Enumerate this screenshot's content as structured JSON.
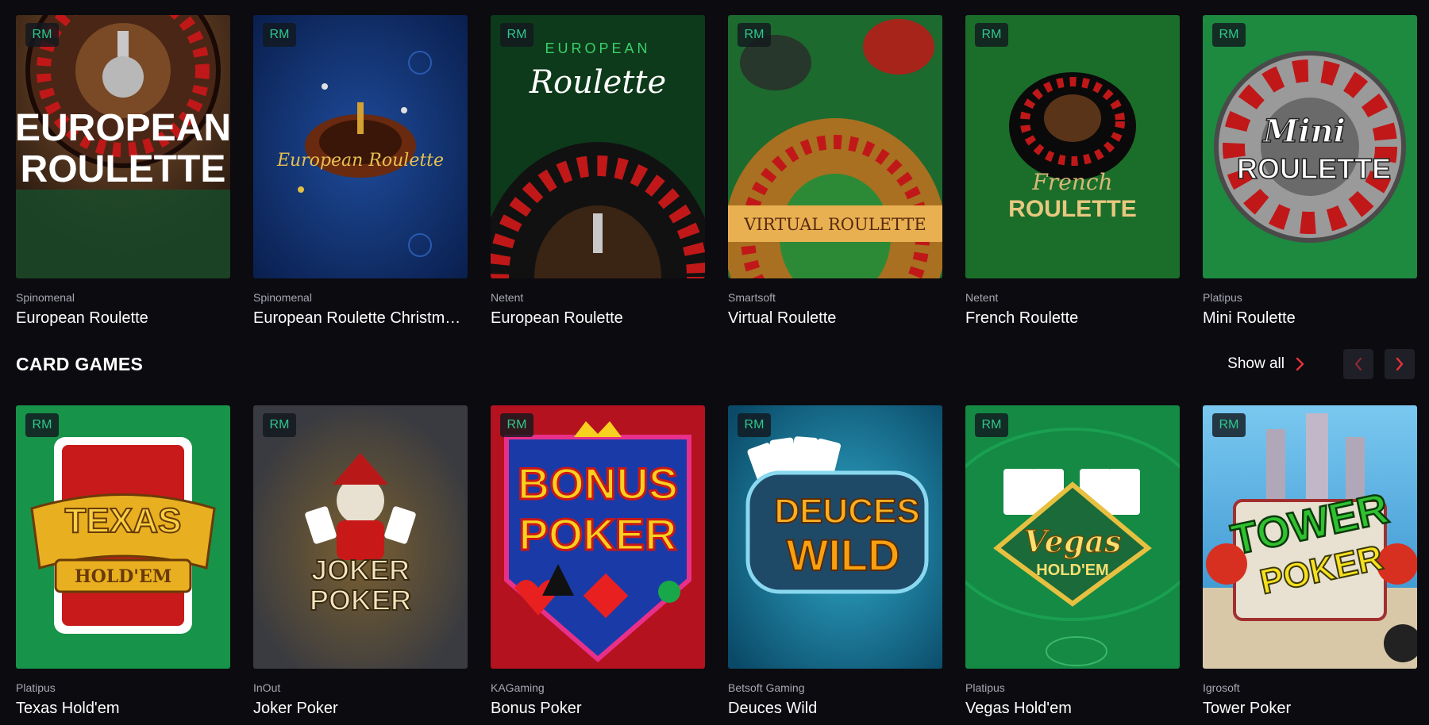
{
  "badge_label": "RM",
  "roulette_row": [
    {
      "provider": "Spinomenal",
      "title": "European Roulette",
      "art_text": [
        "EUROPEAN",
        "ROULETTE"
      ],
      "bg": "#5a3a22"
    },
    {
      "provider": "Spinomenal",
      "title": "European Roulette Christmas Edition",
      "art_text": [
        "European Roulette"
      ],
      "bg": "#10306a"
    },
    {
      "provider": "Netent",
      "title": "European Roulette",
      "art_text": [
        "EUROPEAN",
        "Roulette"
      ],
      "bg": "#0d3a1a"
    },
    {
      "provider": "Smartsoft",
      "title": "Virtual Roulette",
      "art_text": [
        "VIRTUAL ROULETTE"
      ],
      "bg": "#1c6a2e"
    },
    {
      "provider": "Netent",
      "title": "French Roulette",
      "art_text": [
        "French",
        "ROULETTE"
      ],
      "bg": "#1b6e2a"
    },
    {
      "provider": "Platipus",
      "title": "Mini Roulette",
      "art_text": [
        "Mini",
        "ROULETTE"
      ],
      "bg": "#1d8a40"
    }
  ],
  "card_games": {
    "section_title": "CARD GAMES",
    "show_all_label": "Show all",
    "items": [
      {
        "provider": "Platipus",
        "title": "Texas Hold'em",
        "art_text": [
          "TEXAS",
          "HOLD'EM"
        ],
        "bg": "#17934a"
      },
      {
        "provider": "InOut",
        "title": "Joker Poker",
        "art_text": [
          "JOKER",
          "POKER"
        ],
        "bg": "#3a3b40"
      },
      {
        "provider": "KAGaming",
        "title": "Bonus Poker",
        "art_text": [
          "BONUS",
          "POKER"
        ],
        "bg": "#b4121e"
      },
      {
        "provider": "Betsoft Gaming",
        "title": "Deuces Wild",
        "art_text": [
          "DEUCES",
          "WILD"
        ],
        "bg": "#1a7c98"
      },
      {
        "provider": "Platipus",
        "title": "Vegas Hold'em",
        "art_text": [
          "Vegas",
          "HOLD'EM"
        ],
        "bg": "#148a44"
      },
      {
        "provider": "Igrosoft",
        "title": "Tower Poker",
        "art_text": [
          "TOWER",
          "POKER"
        ],
        "bg": "#4aa0d8"
      }
    ]
  },
  "colors": {
    "page_bg": "#0b0b10",
    "badge_text": "#2ec88d",
    "accent_red": "#e8323c",
    "nav_button_bg": "#1e1f27"
  },
  "icons": {
    "show_all": "chevron-right-icon",
    "prev": "chevron-left-icon",
    "next": "chevron-right-icon"
  }
}
